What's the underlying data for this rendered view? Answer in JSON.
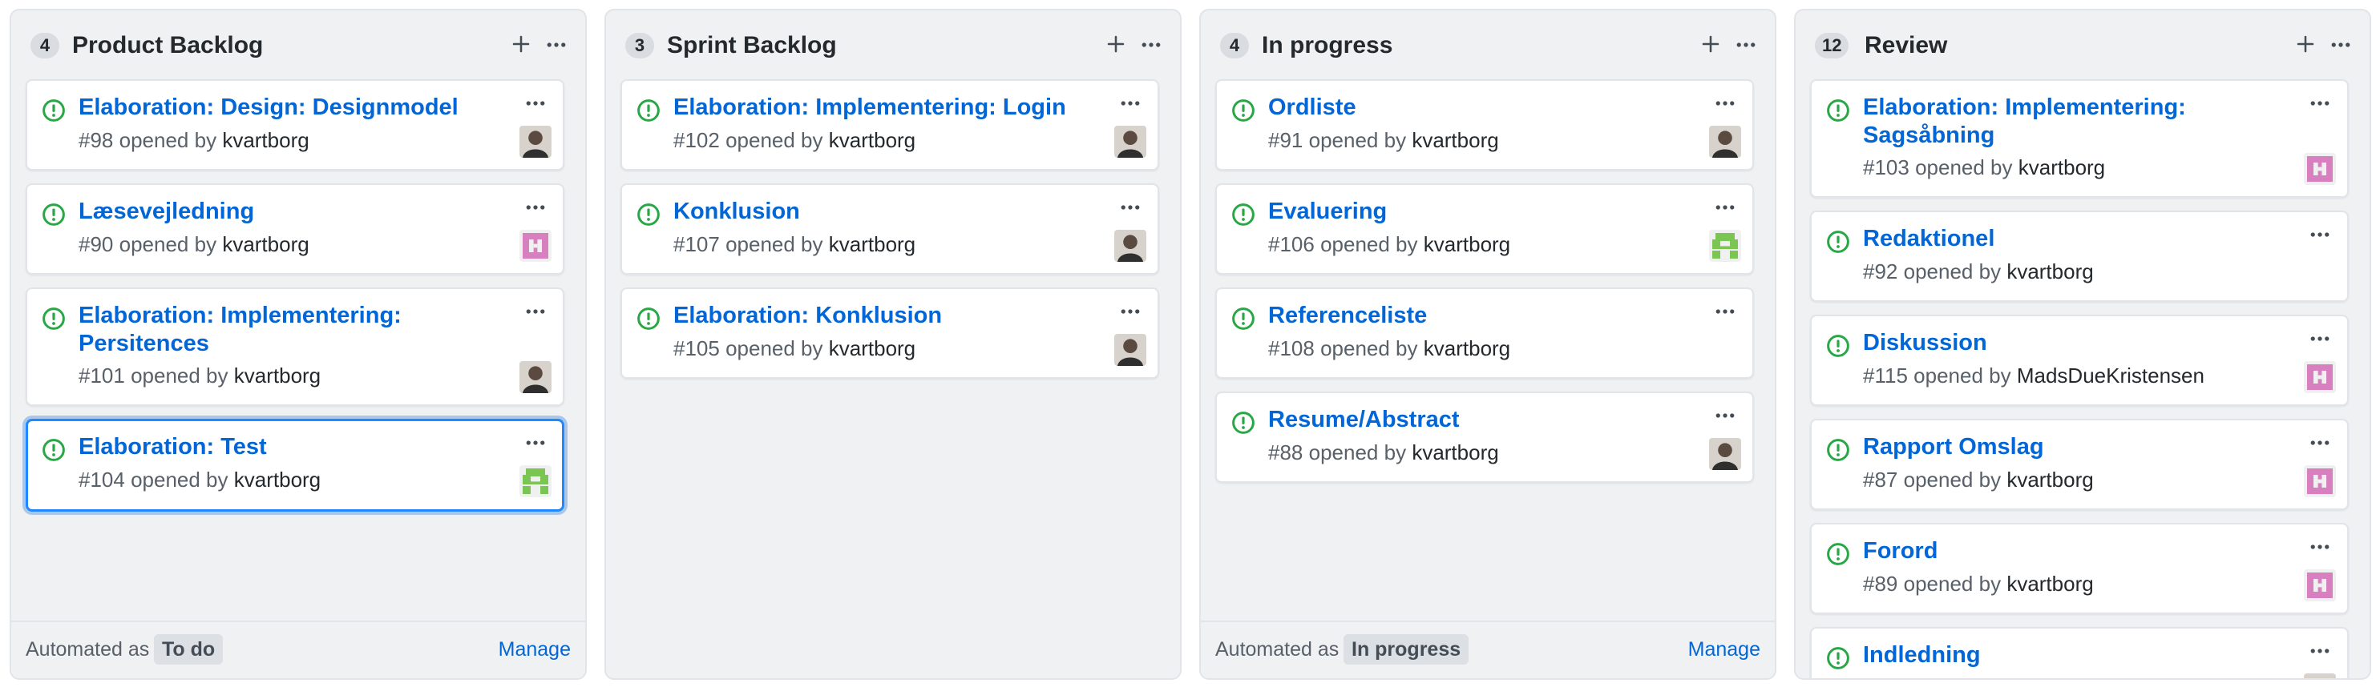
{
  "colors": {
    "link": "#0366d6",
    "open_issue": "#28a745",
    "selected_border": "#2188ff",
    "column_bg": "#eff1f3"
  },
  "icons": {
    "issue": "issue-opened-icon",
    "add": "plus-icon",
    "menu": "kebab-horizontal-icon"
  },
  "columns": [
    {
      "count": "4",
      "title": "Product Backlog",
      "cards": [
        {
          "title": "Elaboration: Design: Designmodel",
          "number": "#98",
          "opened_by": "opened by",
          "author": "kvartborg",
          "avatar": "photo-avatar"
        },
        {
          "title": "Læsevejledning",
          "number": "#90",
          "opened_by": "opened by",
          "author": "kvartborg",
          "avatar": "pink-identicon-avatar"
        },
        {
          "title": "Elaboration: Implementering: Persitences",
          "number": "#101",
          "opened_by": "opened by",
          "author": "kvartborg",
          "avatar": "photo-avatar"
        },
        {
          "title": "Elaboration: Test",
          "number": "#104",
          "opened_by": "opened by",
          "author": "kvartborg",
          "avatar": "green-identicon-avatar"
        }
      ],
      "footer": {
        "label": "Automated as",
        "value": "To do",
        "manage": "Manage"
      }
    },
    {
      "count": "3",
      "title": "Sprint Backlog",
      "cards": [
        {
          "title": "Elaboration: Implementering: Login",
          "number": "#102",
          "opened_by": "opened by",
          "author": "kvartborg",
          "avatar": "photo-avatar"
        },
        {
          "title": "Konklusion",
          "number": "#107",
          "opened_by": "opened by",
          "author": "kvartborg",
          "avatar": "photo-avatar"
        },
        {
          "title": "Elaboration: Konklusion",
          "number": "#105",
          "opened_by": "opened by",
          "author": "kvartborg",
          "avatar": "photo-avatar"
        }
      ]
    },
    {
      "count": "4",
      "title": "In progress",
      "cards": [
        {
          "title": "Ordliste",
          "number": "#91",
          "opened_by": "opened by",
          "author": "kvartborg",
          "avatar": "photo-avatar"
        },
        {
          "title": "Evaluering",
          "number": "#106",
          "opened_by": "opened by",
          "author": "kvartborg",
          "avatar": "green-identicon-avatar"
        },
        {
          "title": "Referenceliste",
          "number": "#108",
          "opened_by": "opened by",
          "author": "kvartborg",
          "avatar": "none"
        },
        {
          "title": "Resume/Abstract",
          "number": "#88",
          "opened_by": "opened by",
          "author": "kvartborg",
          "avatar": "photo-avatar"
        }
      ],
      "footer": {
        "label": "Automated as",
        "value": "In progress",
        "manage": "Manage"
      }
    },
    {
      "count": "12",
      "title": "Review",
      "cards": [
        {
          "title": "Elaboration: Implementering: Sagsåbning",
          "number": "#103",
          "opened_by": "opened by",
          "author": "kvartborg",
          "avatar": "pink-identicon-avatar"
        },
        {
          "title": "Redaktionel",
          "number": "#92",
          "opened_by": "opened by",
          "author": "kvartborg",
          "avatar": "none"
        },
        {
          "title": "Diskussion",
          "number": "#115",
          "opened_by": "opened by",
          "author": "MadsDueKristensen",
          "avatar": "pink-identicon-avatar"
        },
        {
          "title": "Rapport Omslag",
          "number": "#87",
          "opened_by": "opened by",
          "author": "kvartborg",
          "avatar": "pink-identicon-avatar"
        },
        {
          "title": "Forord",
          "number": "#89",
          "opened_by": "opened by",
          "author": "kvartborg",
          "avatar": "pink-identicon-avatar"
        },
        {
          "title": "Indledning",
          "number": "",
          "opened_by": "",
          "author": "",
          "avatar": "photo-avatar"
        }
      ]
    }
  ]
}
